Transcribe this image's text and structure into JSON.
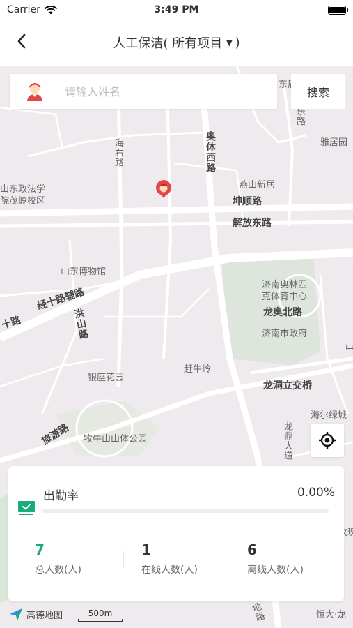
{
  "status_bar": {
    "carrier": "Carrier",
    "time": "3:49 PM"
  },
  "nav": {
    "title": "人工保洁( 所有项目",
    "title_close": ")"
  },
  "search": {
    "placeholder": "请输入姓名",
    "button_label": "搜索"
  },
  "map": {
    "labels": [
      "东辰",
      "雅",
      "乐路",
      "雅居园",
      "海右路",
      "奥体西路",
      "燕山新居",
      "山东政法学",
      "院茂岭校区",
      "坤顺路",
      "解放东路",
      "山东博物馆",
      "济南奥林匹",
      "克体育中心",
      "龙奥北路",
      "经十路辅路",
      "十路",
      "洪山路",
      "济南市政府",
      "赶牛岭",
      "银座花园",
      "龙洞立交桥",
      "中",
      "海尔绿城",
      "旅游路",
      "牧牛山山体公园",
      "龙鼎大道",
      "玫瑰",
      "恒大·龙",
      "地路"
    ],
    "logo_text": "高德地图",
    "scale_text": "500m"
  },
  "stats": {
    "attendance_label": "出勤率",
    "attendance_value": "0.00%",
    "attendance_fraction": 0.0,
    "total": {
      "value": "7",
      "label": "总人数(人)"
    },
    "online": {
      "value": "1",
      "label": "在线人数(人)"
    },
    "offline": {
      "value": "6",
      "label": "离线人数(人)"
    }
  },
  "colors": {
    "accent": "#1aab7a",
    "map_bg": "#eeeaee",
    "pin": "#e04848"
  },
  "icons": [
    "back-icon",
    "wifi-icon",
    "battery-icon",
    "avatar-icon",
    "locate-icon",
    "attendance-icon",
    "amap-logo-icon"
  ]
}
